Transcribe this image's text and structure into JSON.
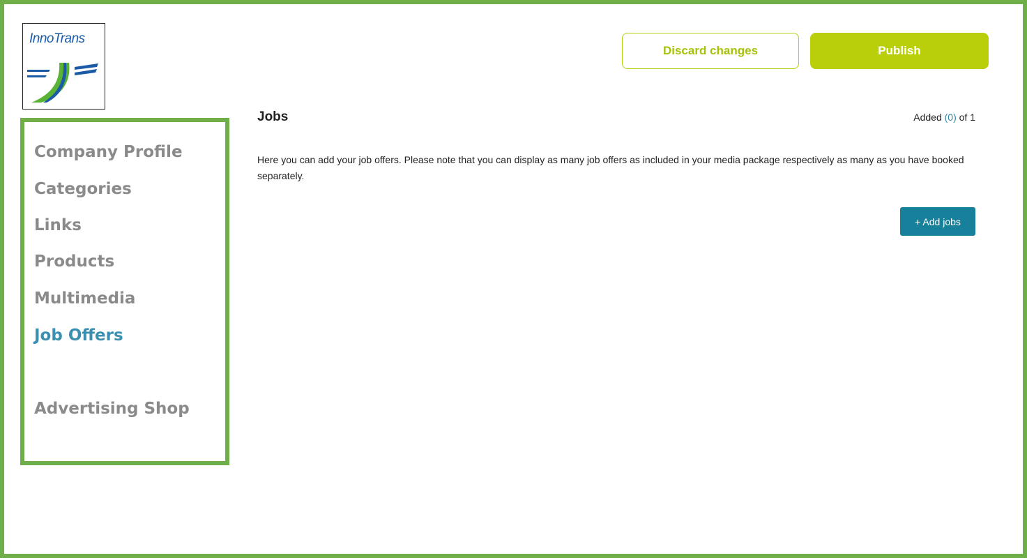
{
  "logo": {
    "text": "InnoTrans"
  },
  "header": {
    "discard_label": "Discard changes",
    "publish_label": "Publish"
  },
  "sidebar": {
    "items": [
      {
        "label": "Company Profile",
        "active": false
      },
      {
        "label": "Categories",
        "active": false
      },
      {
        "label": "Links",
        "active": false
      },
      {
        "label": "Products",
        "active": false
      },
      {
        "label": "Multimedia",
        "active": false
      },
      {
        "label": "Job Offers",
        "active": true
      },
      {
        "label": "Advertising Shop",
        "active": false
      }
    ]
  },
  "main": {
    "title": "Jobs",
    "added_prefix": "Added ",
    "added_count": "(0)",
    "added_suffix": " of 1",
    "description": "Here you can add your job offers. Please note that you can display as many job offers as included in your media package respectively as many as you have booked separately.",
    "add_button_label": "+ Add jobs"
  },
  "colors": {
    "frame_green": "#6fae48",
    "accent_lime": "#b9cf0a",
    "active_blue": "#3b8fb0",
    "button_teal": "#17809a",
    "inactive_gray": "#8a8a8a"
  }
}
